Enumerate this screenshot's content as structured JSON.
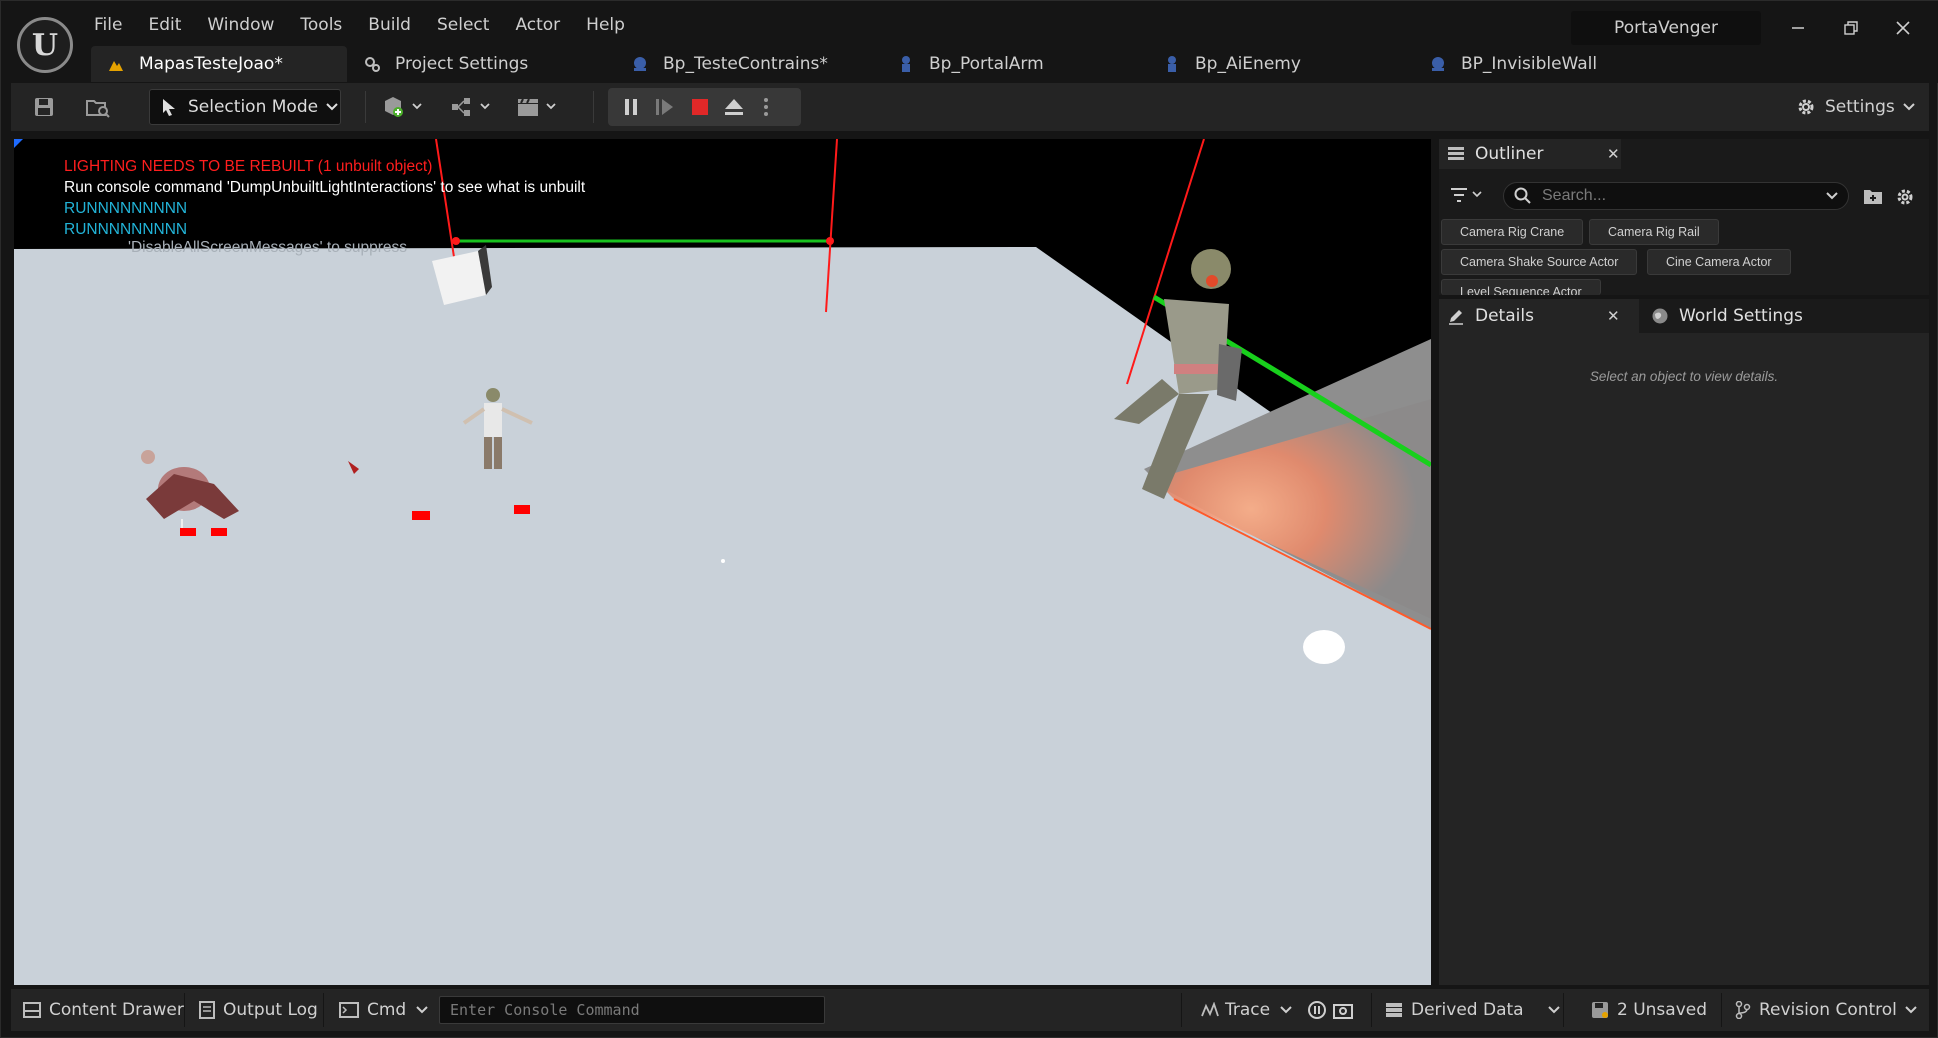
{
  "menu": [
    "File",
    "Edit",
    "Window",
    "Tools",
    "Build",
    "Select",
    "Actor",
    "Help"
  ],
  "project_name": "PortaVenger",
  "tabs": [
    {
      "label": "MapasTesteJoao*",
      "icon": "level-icon",
      "active": true
    },
    {
      "label": "Project Settings",
      "icon": "gears-icon",
      "active": false
    },
    {
      "label": "Bp_TesteContrains*",
      "icon": "blueprint-icon",
      "active": false
    },
    {
      "label": "Bp_PortalArm",
      "icon": "pawn-icon",
      "active": false
    },
    {
      "label": "Bp_AiEnemy",
      "icon": "pawn-icon",
      "active": false
    },
    {
      "label": "BP_InvisibleWall",
      "icon": "blueprint-icon",
      "active": false
    }
  ],
  "toolbar": {
    "mode_label": "Selection Mode",
    "settings_label": "Settings"
  },
  "viewport": {
    "messages": {
      "lighting": "LIGHTING NEEDS TO BE REBUILT (1 unbuilt object)",
      "console_hint": "Run console command 'DumpUnbuiltLightInteractions' to see what is unbuilt",
      "run1": "RUNNNNNNNNN",
      "run2": "RUNNNNNNNNN",
      "suppress": "'DisableAllScreenMessages' to suppress"
    },
    "colors": {
      "lighting": "#ff1e1e",
      "run": "#22b4d8",
      "hint": "#ffffff"
    }
  },
  "outliner": {
    "title": "Outliner",
    "search_placeholder": "Search...",
    "chips": [
      "Camera Rig Crane",
      "Camera Rig Rail",
      "Camera Shake Source Actor",
      "Cine Camera Actor",
      "Level Sequence Actor"
    ]
  },
  "details": {
    "title": "Details",
    "world_settings": "World Settings",
    "empty_message": "Select an object to view details."
  },
  "statusbar": {
    "content_drawer": "Content Drawer",
    "output_log": "Output Log",
    "cmd": "Cmd",
    "console_placeholder": "Enter Console Command",
    "trace": "Trace",
    "derived_data": "Derived Data",
    "unsaved": "2 Unsaved",
    "revision_control": "Revision Control"
  }
}
